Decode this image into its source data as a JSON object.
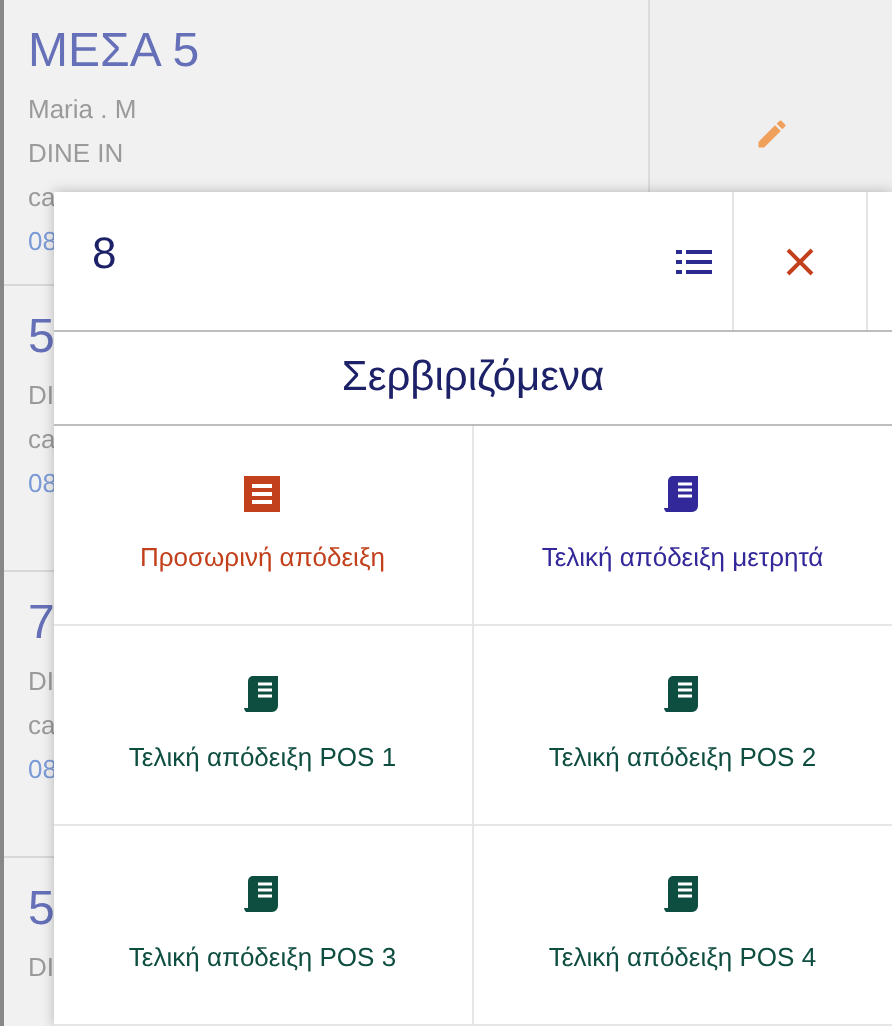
{
  "cards": [
    {
      "title": "ΜΕΣΑ 5",
      "lines": [
        "Maria . M",
        "DINE IN",
        "ca"
      ],
      "time": "08",
      "editable": true
    },
    {
      "title": "5",
      "lines": [
        "DI",
        "ca"
      ],
      "time": "08"
    },
    {
      "title": "7",
      "lines": [
        "DI",
        "ca"
      ],
      "time": "08"
    },
    {
      "title": "5",
      "lines": [
        "DI"
      ]
    }
  ],
  "dialog": {
    "table_number": "8",
    "title": "Σερβιριζόμενα",
    "actions": [
      {
        "label": "Προσωρινή απόδειξη",
        "kind": "temporary"
      },
      {
        "label": "Τελική απόδειξη μετρητά",
        "kind": "cash"
      },
      {
        "label": "Τελική απόδειξη POS 1",
        "kind": "pos"
      },
      {
        "label": "Τελική απόδειξη POS 2",
        "kind": "pos"
      },
      {
        "label": "Τελική απόδειξη POS 3",
        "kind": "pos"
      },
      {
        "label": "Τελική απόδειξη POS 4",
        "kind": "pos"
      }
    ]
  }
}
